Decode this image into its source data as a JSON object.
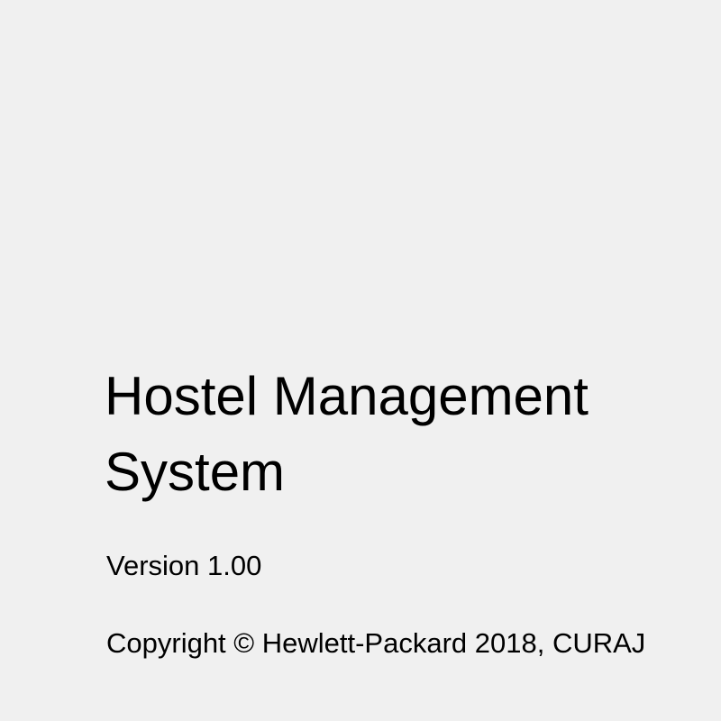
{
  "splash": {
    "title_line1": "Hostel Management",
    "title_line2": "System",
    "version": "Version 1.00",
    "copyright": "Copyright © Hewlett-Packard 2018, CURAJ"
  },
  "colors": {
    "background": "#f0f0f0",
    "text": "#000000"
  }
}
